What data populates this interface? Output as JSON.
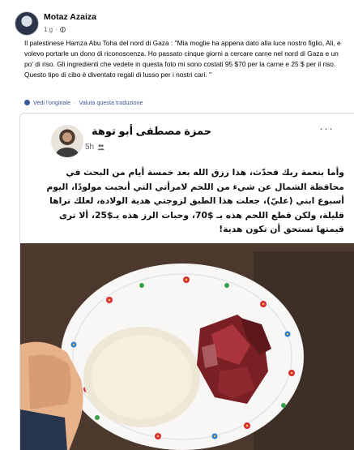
{
  "post": {
    "author": "Motaz Azaiza",
    "time": "1 g",
    "caption": "Il palestinese Hamza Abu Toha del nord di Gaza : \"Mia moglie ha appena dato alla luce nostro figlio, Ali, e volevo portarle un dono di riconoscenza. Ho passato cinque giorni a cercare carne nel nord di Gaza e un po' di riso. Gli ingredienti che vedete in questa foto mi sono costati 95 $70 per la carne e 25 $ per il riso. Questo tipo di cibo è diventato regali di lusso per i nostri cari. \"",
    "see_original": "Vedi l'originale",
    "separator": "·",
    "rate_translation": "Valuta questa traduzione"
  },
  "embedded": {
    "author": "حمزة مصطفى أبو توهة",
    "time": "5h",
    "more": "···",
    "text": "وأما بنعمة ربك فحدّث، هذا رزق الله بعد خمسة أيام من البحث في محافظة الشمال عن شيء من اللحم لامرأتي التي أنجبت مولودًا، اليوم أسبوع ابني (عليّ)، جعلت هذا الطبق لزوجتي هدية الولادة، لعلك تراها قليلة، ولكن قطع اللحم هذه بـ $70، وحبات الرز هذه بـ$25، ألا ترى قيمتها تستحق أن تكون هدية!"
  },
  "icons": {
    "privacy": "friends-icon",
    "translate": "translate-icon",
    "menu": "more-icon"
  }
}
